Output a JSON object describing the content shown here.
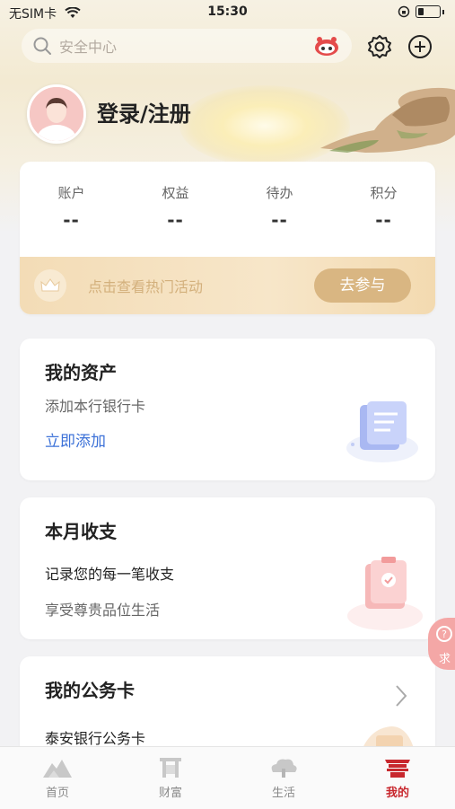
{
  "status_bar": {
    "carrier": "无SIM卡",
    "time": "15:30"
  },
  "search": {
    "placeholder": "安全中心"
  },
  "profile": {
    "login_label": "登录/注册"
  },
  "stats": [
    {
      "label": "账户",
      "value": "--"
    },
    {
      "label": "权益",
      "value": "--"
    },
    {
      "label": "待办",
      "value": "--"
    },
    {
      "label": "积分",
      "value": "--"
    }
  ],
  "promo": {
    "text": "点击查看热门活动",
    "button": "去参与"
  },
  "assets": {
    "title": "我的资产",
    "subtitle": "添加本行银行卡",
    "link": "立即添加"
  },
  "income": {
    "title": "本月收支",
    "line1": "记录您的每一笔收支",
    "line2": "享受尊贵品位生活"
  },
  "business_card": {
    "title": "我的公务卡",
    "subtitle": "泰安银行公务卡"
  },
  "float_button": {
    "label": "求"
  },
  "tabs": [
    {
      "label": "首页",
      "icon": "home-icon"
    },
    {
      "label": "财富",
      "icon": "wealth-icon"
    },
    {
      "label": "生活",
      "icon": "life-icon"
    },
    {
      "label": "我的",
      "icon": "mine-icon"
    }
  ],
  "colors": {
    "accent": "#c8282e",
    "gold": "#d9b682",
    "link": "#3d72d8"
  }
}
